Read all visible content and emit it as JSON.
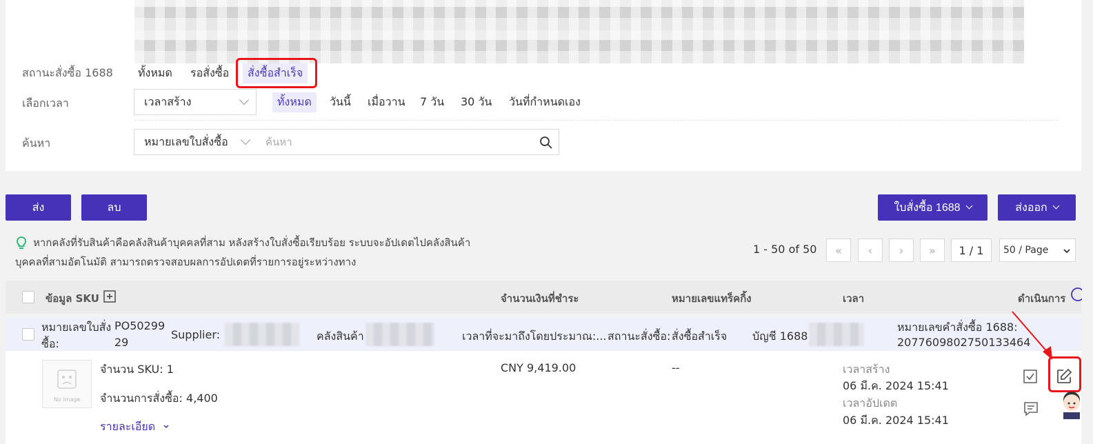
{
  "filters": {
    "status": {
      "label": "สถานะสั่งซื้อ 1688",
      "options": [
        "ทั้งหมด",
        "รอสั่งซื้อ",
        "สั่งซื้อสำเร็จ"
      ],
      "selected": "สั่งซื้อสำเร็จ"
    },
    "time": {
      "label": "เลือกเวลา",
      "select_value": "เวลาสร้าง",
      "options": [
        "ทั้งหมด",
        "วันนี้",
        "เมื่อวาน",
        "7 วัน",
        "30 วัน",
        "วันที่กำหนดเอง"
      ],
      "selected": "ทั้งหมด"
    },
    "search": {
      "label": "ค้นหา",
      "select_value": "หมายเลขใบสั่งซื้อ",
      "placeholder": "ค้นหา"
    }
  },
  "toolbar": {
    "send_label": "ส่ง",
    "delete_label": "ลบ",
    "po1688_label": "ใบสั่งซื้อ 1688",
    "export_label": "ส่งออก"
  },
  "notice": {
    "line1": "หากคลังที่รับสินค้าคือคลังสินค้าบุคคลที่สาม หลังสร้างใบสั่งซื้อเรียบร้อย ระบบจะอัปเดตไปคลังสินค้า",
    "line2": "บุคคลที่สามอัตโนมัติ สามารถตรวจสอบผลการอัปเดตที่รายการอยู่ระหว่างทาง"
  },
  "pagination": {
    "info": "1 - 50 of 50",
    "page": "1 / 1",
    "page_size": "50 / Page"
  },
  "table": {
    "headers": {
      "sku_info": "ข้อมูล SKU",
      "amount": "จำนวนเงินที่ชำระ",
      "tracking": "หมายเลขแทร็คกิ้ง",
      "time": "เวลา",
      "action": "ดำเนินการ"
    }
  },
  "order": {
    "po_label_1": "หมายเลขใบสั่ง",
    "po_label_2": "ซื้อ:",
    "po_number_1": "PO50299",
    "po_number_2": "29",
    "supplier_label": "Supplier:",
    "warehouse_label": "คลังสินค้า",
    "eta_label": "เวลาที่จะมาถึงโดยประมาณ:...",
    "status_label": "สถานะสั่งซื้อ:",
    "status_value": "สั่งซื้อสำเร็จ",
    "account_label": "บัญชี 1688",
    "order1688_label": "หมายเลขคำสั่งซื้อ 1688:",
    "order1688_number": "2077609802750133464",
    "sku_count": "จำนวน SKU: 1",
    "order_qty": "จำนวนการสั่งซื้อ: 4,400",
    "detail_link": "รายละเอียด",
    "amount": "CNY 9,419.00",
    "tracking": "--",
    "created_label": "เวลาสร้าง",
    "created_time": "06 มี.ค. 2024 15:41",
    "updated_label": "เวลาอัปเดต",
    "updated_time": "06 มี.ค. 2024 15:41",
    "thumb_text": "No image"
  },
  "colors": {
    "primary": "#4532b8",
    "highlight": "#e8151b",
    "active_chip_bg": "#ecebfb"
  }
}
